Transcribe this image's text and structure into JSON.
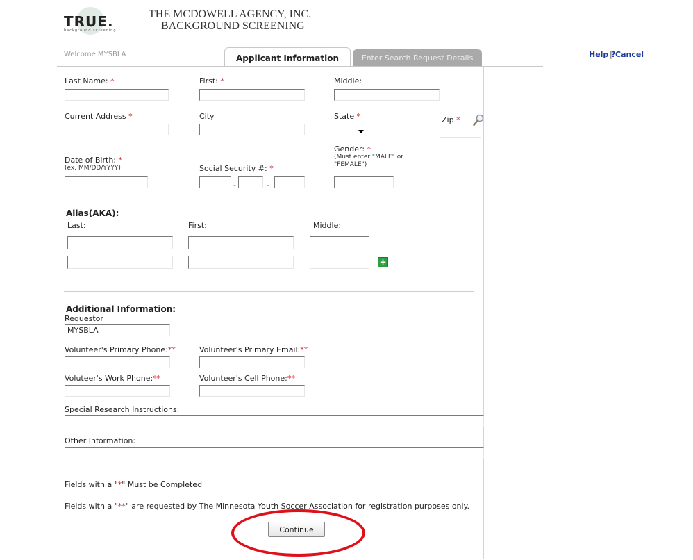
{
  "brand": {
    "logo_text": "TRUE.",
    "logo_subtext": "background screening",
    "company_line1": "THE MCDOWELL AGENCY, INC.",
    "company_line2": "BACKGROUND SCREENING"
  },
  "header": {
    "welcome": "Welcome MYSBLA",
    "tabs": [
      {
        "label": "Applicant Information",
        "active": true
      },
      {
        "label": "Enter Search Request Details",
        "active": false
      }
    ],
    "help_label": "Help ?",
    "divider": "|",
    "cancel_label": "Cancel"
  },
  "applicant": {
    "last_name_label": "Last Name:",
    "first_label": "First:",
    "middle_label": "Middle:",
    "address_label": "Current Address",
    "city_label": "City",
    "state_label": "State",
    "zip_label": "Zip",
    "dob_label": "Date of Birth:",
    "dob_hint": "(ex. MM/DD/YYYY)",
    "ssn_label": "Social Security #:",
    "ssn_sep": "-",
    "gender_label": "Gender:",
    "gender_hint_1": "(Must enter \"MALE\" or",
    "gender_hint_2": "\"FEMALE\")",
    "required_mark": "*"
  },
  "alias": {
    "title": "Alias(AKA):",
    "last_label": "Last:",
    "first_label": "First:",
    "middle_label": "Middle:"
  },
  "additional": {
    "title": "Additional Information:",
    "requestor_label": "Requestor",
    "requestor_value": "MYSBLA",
    "primary_phone_label": "Volunteer's Primary Phone:",
    "primary_email_label": "Volunteer's Primary Email:",
    "work_phone_label": "Voluteer's Work Phone:",
    "cell_phone_label": "Volunteer's Cell Phone:",
    "double_req_mark": "**",
    "special_label": "Special Research Instructions:",
    "other_label": "Other Information:"
  },
  "notes": {
    "note1_prefix": "Fields with a \"",
    "note1_mark": "*",
    "note1_suffix": "\" Must be Completed",
    "note2_prefix": "Fields with a \"",
    "note2_mark": "**",
    "note2_suffix": "\" are requested by The Minnesota Youth Soccer Association for registration purposes only."
  },
  "actions": {
    "continue_label": "Continue"
  },
  "colors": {
    "required": "#d8232a",
    "link": "#1f3a9e",
    "annotation_oval": "#e0101a",
    "add_button": "#2ea043"
  },
  "icons": {
    "zip_lookup": "magnifier-icon",
    "add_alias": "plus-icon"
  }
}
